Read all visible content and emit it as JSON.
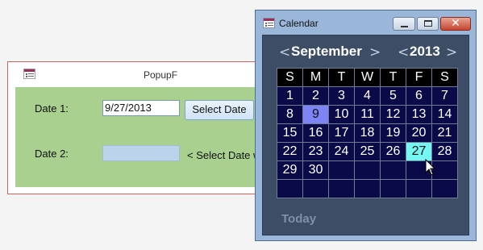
{
  "form": {
    "title": "PopupF",
    "date1_label": "Date 1:",
    "date1_value": "9/27/2013",
    "select_button_label": "Select Date",
    "date2_label": "Date 2:",
    "date2_value": "",
    "date2_hint": "< Select Date w"
  },
  "calendar": {
    "title": "Calendar",
    "prev_month_arrow": "<",
    "month": "September",
    "next_month_arrow": ">",
    "prev_year_arrow": "<",
    "year": "2013",
    "next_year_arrow": ">",
    "weekdays": [
      "S",
      "M",
      "T",
      "W",
      "T",
      "F",
      "S"
    ],
    "weeks": [
      [
        "1",
        "2",
        "3",
        "4",
        "5",
        "6",
        "7"
      ],
      [
        "8",
        "9",
        "10",
        "11",
        "12",
        "13",
        "14"
      ],
      [
        "15",
        "16",
        "17",
        "18",
        "19",
        "20",
        "21"
      ],
      [
        "22",
        "23",
        "24",
        "25",
        "26",
        "27",
        "28"
      ],
      [
        "29",
        "30",
        "",
        "",
        "",
        "",
        ""
      ],
      [
        "",
        "",
        "",
        "",
        "",
        "",
        ""
      ]
    ],
    "today_day": "9",
    "selected_day": "27",
    "today_button_label": "Today",
    "close_glyph": "✕"
  },
  "colors": {
    "form_body": "#a9d08e",
    "calendar_frame": "#9ab6d8",
    "calendar_client": "#3d4d66",
    "day_cell": "#0a0a48",
    "today_highlight": "#7d84f5",
    "selected_highlight": "#74f6f2"
  },
  "icons": [
    "form-icon",
    "calendar-window-icon",
    "minimize-icon",
    "maximize-icon",
    "close-icon",
    "mouse-pointer-icon"
  ]
}
